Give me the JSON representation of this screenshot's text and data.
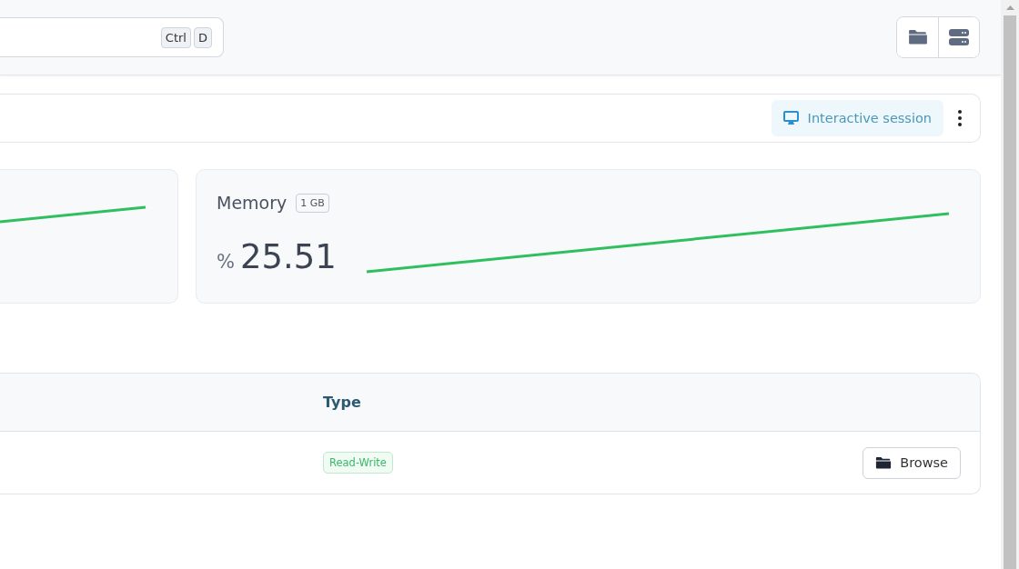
{
  "search": {
    "shortcut_keys": [
      "Ctrl",
      "D"
    ]
  },
  "session_bar": {
    "button": "Interactive session"
  },
  "metrics": [
    {
      "kind": "partial"
    },
    {
      "kind": "full",
      "title": "Memory",
      "badge": "1 GB",
      "unit": "%",
      "value": "25.51"
    }
  ],
  "table": {
    "columns": [
      "Type"
    ],
    "rows": [
      {
        "type": "Read-Write",
        "action": "Browse"
      }
    ]
  }
}
